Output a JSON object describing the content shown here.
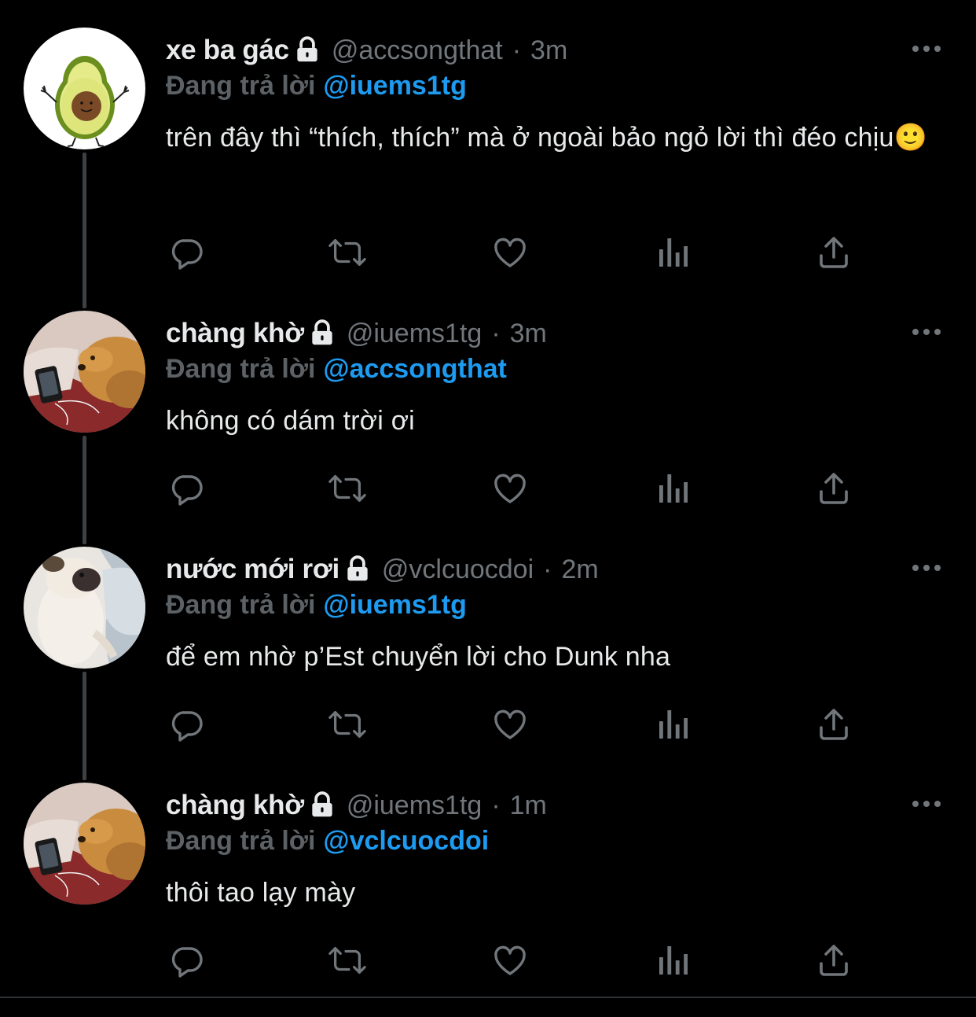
{
  "colors": {
    "background": "#000000",
    "text_primary": "#e7e9ea",
    "text_secondary": "#71767b",
    "reply_prefix": "#5c6166",
    "mention": "#1d9bf0",
    "thread_line": "#3e4144"
  },
  "tweets": [
    {
      "display_name": "xe ba gác",
      "handle": "@accsongthat",
      "separator": "·",
      "time": "3m",
      "reply_prefix": "Đang trả lời",
      "reply_to": "@iuems1tg",
      "text": "trên đây thì “thích, thích” mà ở ngoài bảo ngỏ lời thì đéo chịu🙂",
      "avatar_icon": "avocado-avatar",
      "locked": true
    },
    {
      "display_name": "chàng khờ",
      "handle": "@iuems1tg",
      "separator": "·",
      "time": "3m",
      "reply_prefix": "Đang trả lời",
      "reply_to": "@accsongthat",
      "text": "không có dám trời ơi",
      "avatar_icon": "dog-avatar",
      "locked": true
    },
    {
      "display_name": "nước mới rơi",
      "handle": "@vclcuocdoi",
      "separator": "·",
      "time": "2m",
      "reply_prefix": "Đang trả lời",
      "reply_to": "@iuems1tg",
      "text": "để em nhờ p’Est chuyển lời cho Dunk nha",
      "avatar_icon": "pug-avatar",
      "locked": true
    },
    {
      "display_name": "chàng khờ",
      "handle": "@iuems1tg",
      "separator": "·",
      "time": "1m",
      "reply_prefix": "Đang trả lời",
      "reply_to": "@vclcuocdoi",
      "text": "thôi tao lạy mày",
      "avatar_icon": "dog-avatar",
      "locked": true
    }
  ],
  "actions": [
    "reply-icon",
    "retweet-icon",
    "like-icon",
    "analytics-icon",
    "share-icon"
  ]
}
